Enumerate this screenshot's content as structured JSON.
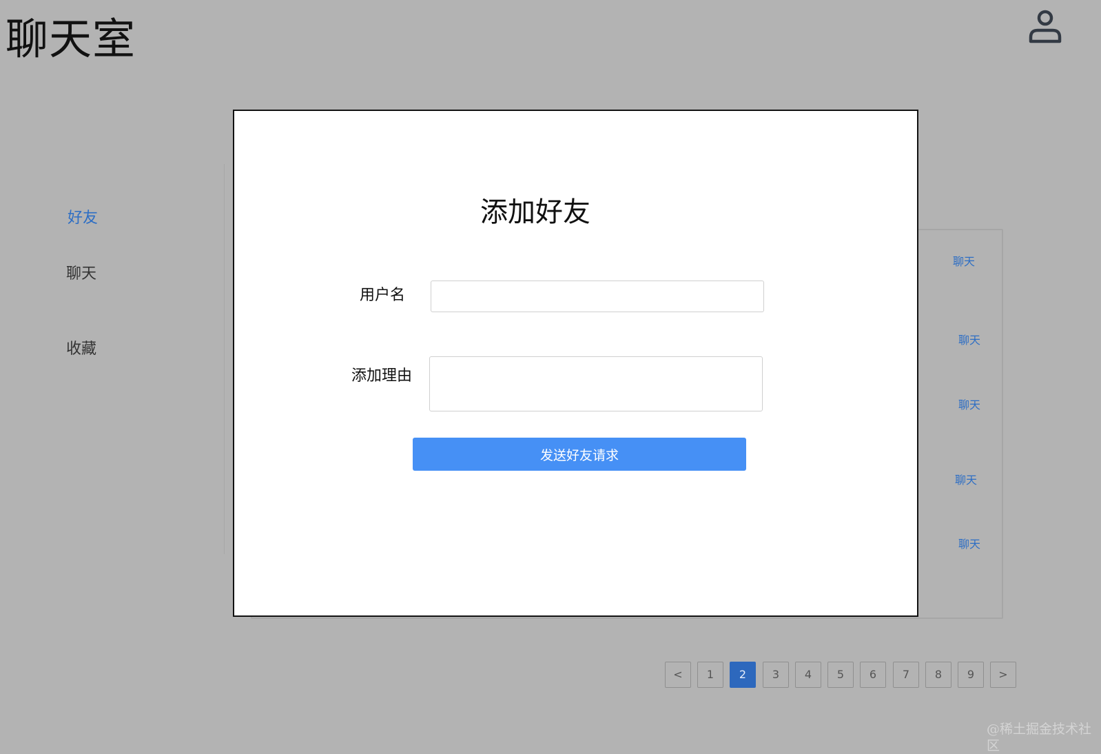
{
  "header": {
    "title": "聊天室",
    "user_icon": "user-icon"
  },
  "sidebar": {
    "items": [
      {
        "label": "好友",
        "active": true
      },
      {
        "label": "聊天",
        "active": false
      },
      {
        "label": "收藏",
        "active": false
      }
    ]
  },
  "friend_list": {
    "chat_links": [
      "聊天",
      "聊天",
      "聊天",
      "聊天",
      "聊天"
    ]
  },
  "pagination": {
    "prev_label": "<",
    "next_label": ">",
    "pages": [
      "1",
      "2",
      "3",
      "4",
      "5",
      "6",
      "7",
      "8",
      "9"
    ],
    "current_page": "2"
  },
  "modal": {
    "title": "添加好友",
    "username_label": "用户名",
    "username_value": "",
    "reason_label": "添加理由",
    "reason_value": "",
    "submit_label": "发送好友请求"
  },
  "watermark": "@稀土掘金技术社区",
  "colors": {
    "accent": "#2d6ec4",
    "submit_button": "#4690f5",
    "active_page": "#2d68bd",
    "backdrop": "#b3b3b3"
  }
}
